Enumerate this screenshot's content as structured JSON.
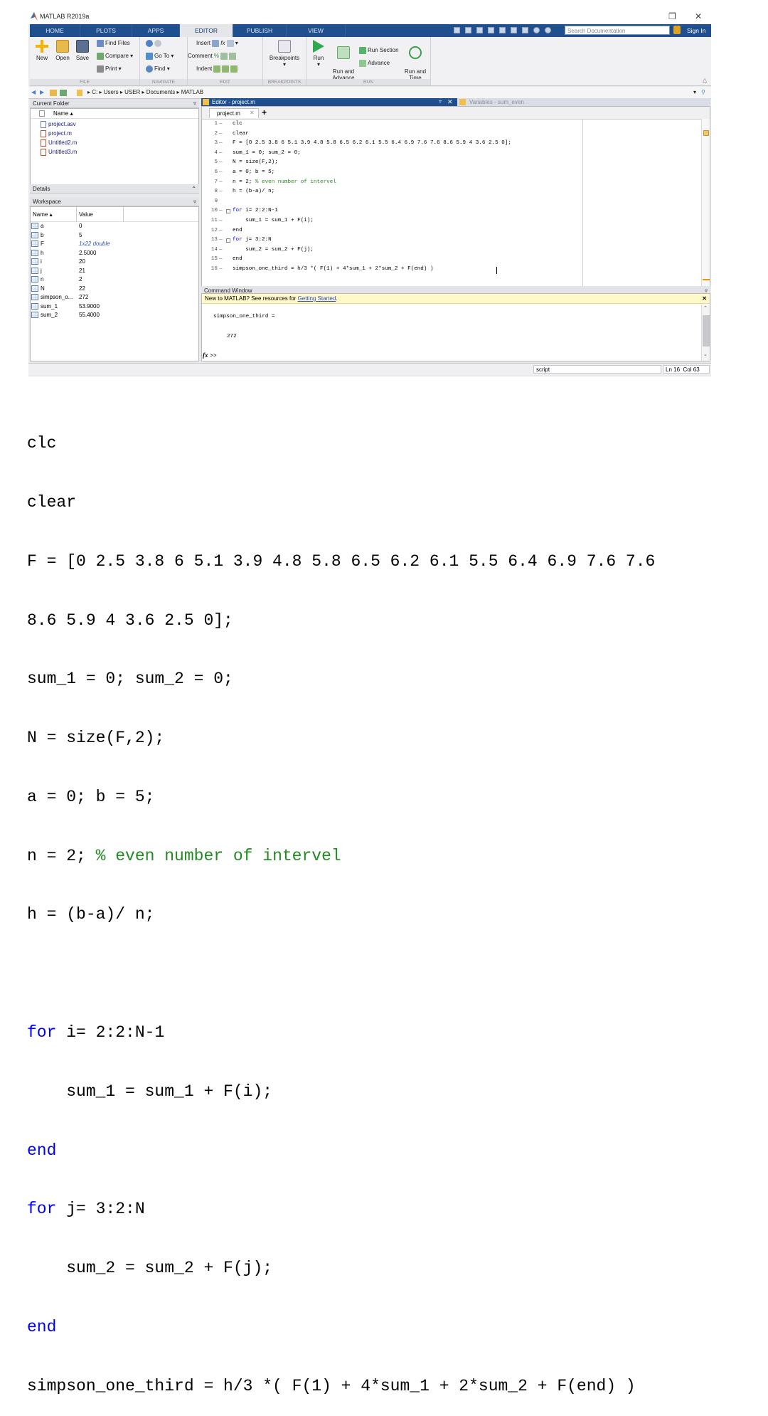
{
  "window": {
    "title": "MATLAB R2019a"
  },
  "ribbon": {
    "tabs": [
      "HOME",
      "PLOTS",
      "APPS",
      "EDITOR",
      "PUBLISH",
      "VIEW"
    ],
    "active_tab": "EDITOR",
    "search_placeholder": "Search Documentation",
    "sign_in": "Sign In",
    "sections": [
      {
        "label": "FILE"
      },
      {
        "label": "NAVIGATE"
      },
      {
        "label": "EDIT"
      },
      {
        "label": "BREAKPOINTS"
      },
      {
        "label": "RUN"
      }
    ],
    "buttons": {
      "new": "New",
      "open": "Open",
      "save": "Save",
      "find_files": "Find Files",
      "compare": "Compare",
      "print": "Print",
      "go_to": "Go To",
      "find": "Find",
      "insert": "Insert",
      "comment": "Comment",
      "indent": "Indent",
      "breakpoints": "Breakpoints",
      "run": "Run",
      "run_and_advance": "Run and\nAdvance",
      "run_section": "Run Section",
      "advance": "Advance",
      "run_and_time": "Run and\nTime"
    }
  },
  "address": {
    "path": [
      "C:",
      "Users",
      "USER",
      "Documents",
      "MATLAB"
    ]
  },
  "current_folder": {
    "title": "Current Folder",
    "column": "Name",
    "files": [
      "project.asv",
      "project.m",
      "Untitled2.m",
      "Untitled3.m"
    ]
  },
  "details": {
    "title": "Details"
  },
  "workspace": {
    "title": "Workspace",
    "columns": [
      "Name",
      "Value"
    ],
    "rows": [
      {
        "name": "a",
        "value": "0"
      },
      {
        "name": "b",
        "value": "5"
      },
      {
        "name": "F",
        "value": "1x22 double"
      },
      {
        "name": "h",
        "value": "2.5000"
      },
      {
        "name": "i",
        "value": "20"
      },
      {
        "name": "j",
        "value": "21"
      },
      {
        "name": "n",
        "value": "2"
      },
      {
        "name": "N",
        "value": "22"
      },
      {
        "name": "simpson_o...",
        "value": "272"
      },
      {
        "name": "sum_1",
        "value": "53.9000"
      },
      {
        "name": "sum_2",
        "value": "55.4000"
      }
    ]
  },
  "editor": {
    "title": "Editor - project.m",
    "variables_tab": "Variables - sum_even",
    "file_tab": "project.m",
    "lines": [
      "clc",
      "clear",
      "F = [0 2.5 3.8 6 5.1 3.9 4.8 5.8 6.5 6.2 6.1 5.5 6.4 6.9 7.6 7.6 8.6 5.9 4 3.6 2.5 0];",
      "sum_1 = 0; sum_2 = 0;",
      "N = size(F,2);",
      "a = 0; b = 5;",
      "n = 2; ",
      "h = (b-a)/ n;",
      "",
      "for i= 2:2:N-1",
      "    sum_1 = sum_1 + F(i);",
      "end",
      "for j= 3:2:N",
      "    sum_2 = sum_2 + F(j);",
      "end",
      "simpson_one_third = h/3 *( F(1) + 4*sum_1 + 2*sum_2 + F(end) )"
    ],
    "comment_line7": "% even number of intervel",
    "kw_for": "for",
    "kw_end": "end"
  },
  "command_window": {
    "title": "Command Window",
    "notice_prefix": "New to MATLAB? See resources for ",
    "notice_link": "Getting Started",
    "notice_suffix": ".",
    "output_var": "simpson_one_third =",
    "output_value": "272",
    "prompt": ">>"
  },
  "status": {
    "type": "script",
    "ln_label": "Ln",
    "ln": "16",
    "col_label": "Col",
    "col": "63"
  },
  "big_code": {
    "l1": "clc",
    "l2": "clear",
    "l3": "F = [0 2.5 3.8 6 5.1 3.9 4.8 5.8 6.5 6.2 6.1 5.5 6.4 6.9 7.6 7.6",
    "l4": "8.6 5.9 4 3.6 2.5 0];",
    "l5": "sum_1 = 0; sum_2 = 0;",
    "l6": "N = size(F,2);",
    "l7": "a = 0; b = 5;",
    "l8a": "n = 2; ",
    "l8b": "% even number of intervel",
    "l9": "h = (b-a)/ n;",
    "l11a": "for",
    "l11b": " i= 2:2:N-1",
    "l12": "    sum_1 = sum_1 + F(i);",
    "l13": "end",
    "l14a": "for",
    "l14b": " j= 3:2:N",
    "l15": "    sum_2 = sum_2 + F(j);",
    "l16": "end",
    "l17": "simpson_one_third = h/3 *( F(1) + 4*sum_1 + 2*sum_2 + F(end) )"
  },
  "colors": {
    "ribbon_blue": "#1f4f8f",
    "keyword": "#0000ff",
    "comment": "#228b22"
  }
}
